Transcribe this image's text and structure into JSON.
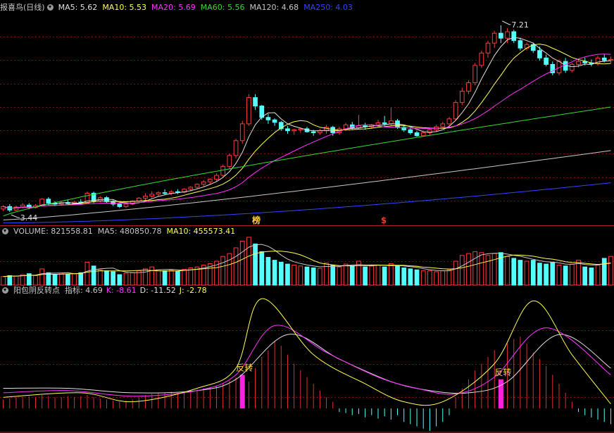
{
  "chart_data": [
    {
      "type": "candlestick",
      "title": "报喜鸟(日线)",
      "indicators": [
        {
          "name": "MA5",
          "value": "5.62",
          "color": "#e0e0e0"
        },
        {
          "name": "MA10",
          "value": "5.53",
          "color": "#ffff55"
        },
        {
          "name": "MA20",
          "value": "5.69",
          "color": "#ff33ff"
        },
        {
          "name": "MA60",
          "value": "5.56",
          "color": "#33dd33"
        },
        {
          "name": "MA120",
          "value": "4.68",
          "color": "#c8c8c8"
        },
        {
          "name": "MA250",
          "value": "4.03",
          "color": "#3344ff"
        }
      ],
      "high_label": "7.21",
      "low_label": "3.44",
      "markers": [
        {
          "text": "榜",
          "color": "#ffcc44"
        },
        {
          "text": "$",
          "color": "#ff3333"
        }
      ],
      "ylim": [
        3.2,
        7.45
      ],
      "bar_count": 95,
      "ohlc": [
        [
          3.5,
          3.58,
          3.46,
          3.55
        ],
        [
          3.55,
          3.6,
          3.44,
          3.48
        ],
        [
          3.48,
          3.57,
          3.46,
          3.54
        ],
        [
          3.54,
          3.62,
          3.51,
          3.58
        ],
        [
          3.58,
          3.62,
          3.5,
          3.53
        ],
        [
          3.53,
          3.6,
          3.51,
          3.57
        ],
        [
          3.57,
          3.72,
          3.55,
          3.7
        ],
        [
          3.7,
          3.74,
          3.58,
          3.62
        ],
        [
          3.62,
          3.66,
          3.56,
          3.6
        ],
        [
          3.6,
          3.65,
          3.57,
          3.63
        ],
        [
          3.63,
          3.68,
          3.59,
          3.61
        ],
        [
          3.61,
          3.66,
          3.58,
          3.64
        ],
        [
          3.64,
          3.7,
          3.6,
          3.62
        ],
        [
          3.62,
          3.85,
          3.6,
          3.82
        ],
        [
          3.82,
          3.85,
          3.62,
          3.66
        ],
        [
          3.66,
          3.76,
          3.64,
          3.73
        ],
        [
          3.73,
          3.76,
          3.62,
          3.65
        ],
        [
          3.65,
          3.68,
          3.56,
          3.6
        ],
        [
          3.6,
          3.62,
          3.52,
          3.55
        ],
        [
          3.55,
          3.63,
          3.52,
          3.6
        ],
        [
          3.6,
          3.68,
          3.58,
          3.66
        ],
        [
          3.66,
          3.74,
          3.64,
          3.72
        ],
        [
          3.72,
          3.82,
          3.68,
          3.76
        ],
        [
          3.76,
          3.86,
          3.72,
          3.8
        ],
        [
          3.8,
          3.86,
          3.76,
          3.83
        ],
        [
          3.83,
          3.9,
          3.78,
          3.82
        ],
        [
          3.82,
          3.88,
          3.78,
          3.85
        ],
        [
          3.85,
          3.9,
          3.8,
          3.84
        ],
        [
          3.84,
          3.92,
          3.82,
          3.9
        ],
        [
          3.9,
          3.96,
          3.86,
          3.94
        ],
        [
          3.94,
          4.02,
          3.9,
          4.0
        ],
        [
          4.0,
          4.08,
          3.96,
          4.05
        ],
        [
          4.05,
          4.12,
          4.0,
          4.1
        ],
        [
          4.1,
          4.22,
          4.06,
          4.18
        ],
        [
          4.18,
          4.4,
          4.15,
          4.36
        ],
        [
          4.36,
          4.62,
          4.3,
          4.58
        ],
        [
          4.58,
          4.92,
          4.52,
          4.88
        ],
        [
          4.88,
          5.28,
          4.82,
          5.22
        ],
        [
          5.22,
          5.82,
          5.18,
          5.75
        ],
        [
          5.75,
          5.82,
          5.5,
          5.58
        ],
        [
          5.58,
          5.6,
          5.3,
          5.35
        ],
        [
          5.35,
          5.42,
          5.22,
          5.3
        ],
        [
          5.3,
          5.33,
          5.18,
          5.25
        ],
        [
          5.25,
          5.28,
          5.08,
          5.12
        ],
        [
          5.12,
          5.18,
          5.02,
          5.08
        ],
        [
          5.08,
          5.12,
          5.0,
          5.1
        ],
        [
          5.1,
          5.14,
          5.04,
          5.12
        ],
        [
          5.12,
          5.16,
          5.04,
          5.06
        ],
        [
          5.06,
          5.1,
          4.98,
          5.04
        ],
        [
          5.04,
          5.12,
          5.0,
          5.08
        ],
        [
          5.08,
          5.2,
          5.02,
          5.15
        ],
        [
          5.15,
          5.18,
          4.98,
          5.04
        ],
        [
          5.04,
          5.16,
          5.0,
          5.12
        ],
        [
          5.12,
          5.24,
          5.08,
          5.2
        ],
        [
          5.2,
          5.26,
          5.1,
          5.14
        ],
        [
          5.14,
          5.4,
          5.12,
          5.18
        ],
        [
          5.18,
          5.24,
          5.1,
          5.16
        ],
        [
          5.16,
          5.22,
          5.12,
          5.2
        ],
        [
          5.2,
          5.3,
          5.16,
          5.24
        ],
        [
          5.24,
          5.38,
          5.18,
          5.22
        ],
        [
          5.22,
          5.55,
          5.18,
          5.28
        ],
        [
          5.28,
          5.32,
          5.12,
          5.15
        ],
        [
          5.15,
          5.2,
          5.06,
          5.1
        ],
        [
          5.1,
          5.14,
          5.0,
          5.04
        ],
        [
          5.04,
          5.08,
          4.96,
          4.98
        ],
        [
          4.98,
          5.06,
          4.96,
          5.04
        ],
        [
          5.04,
          5.14,
          5.0,
          5.1
        ],
        [
          5.1,
          5.2,
          5.06,
          5.16
        ],
        [
          5.16,
          5.26,
          5.12,
          5.22
        ],
        [
          5.22,
          5.36,
          5.18,
          5.32
        ],
        [
          5.32,
          5.7,
          5.3,
          5.65
        ],
        [
          5.65,
          5.95,
          5.6,
          5.88
        ],
        [
          5.88,
          6.1,
          5.82,
          6.05
        ],
        [
          6.05,
          6.45,
          6.0,
          6.4
        ],
        [
          6.4,
          6.7,
          6.35,
          6.65
        ],
        [
          6.65,
          6.9,
          6.55,
          6.85
        ],
        [
          6.85,
          7.1,
          6.75,
          7.05
        ],
        [
          7.05,
          7.21,
          6.85,
          6.95
        ],
        [
          6.95,
          7.15,
          6.85,
          7.08
        ],
        [
          7.08,
          7.12,
          6.85,
          6.9
        ],
        [
          6.9,
          6.96,
          6.7,
          6.75
        ],
        [
          6.75,
          6.86,
          6.7,
          6.82
        ],
        [
          6.82,
          6.86,
          6.65,
          6.7
        ],
        [
          6.7,
          6.78,
          6.5,
          6.55
        ],
        [
          6.55,
          6.62,
          6.38,
          6.42
        ],
        [
          6.42,
          6.48,
          6.2,
          6.25
        ],
        [
          6.25,
          6.52,
          6.2,
          6.48
        ],
        [
          6.48,
          6.55,
          6.25,
          6.3
        ],
        [
          6.3,
          6.45,
          6.26,
          6.42
        ],
        [
          6.42,
          6.52,
          6.36,
          6.48
        ],
        [
          6.48,
          6.56,
          6.4,
          6.45
        ],
        [
          6.45,
          6.52,
          6.38,
          6.44
        ],
        [
          6.44,
          6.6,
          6.4,
          6.55
        ],
        [
          6.55,
          6.62,
          6.46,
          6.5
        ],
        [
          6.5,
          6.58,
          6.44,
          6.52
        ]
      ],
      "ma_series": [
        {
          "name": "MA60",
          "start": 3.36,
          "end": 5.56,
          "bend": 0.85
        },
        {
          "name": "MA120",
          "start": 3.28,
          "end": 4.68,
          "bend": 1.2
        },
        {
          "name": "MA250",
          "start": 3.22,
          "end": 4.03,
          "bend": 1.6
        }
      ]
    },
    {
      "type": "bar",
      "title": "VOLUME",
      "indicators": [
        {
          "name": "VOLUME",
          "value": "821558.81",
          "color": "#c8c8c8"
        },
        {
          "name": "MA5",
          "value": "480850.78",
          "color": "#c8c8c8"
        },
        {
          "name": "MA10",
          "value": "455573.41",
          "color": "#ffff55"
        }
      ],
      "ylim": [
        0,
        1.0
      ],
      "volume": [
        0.18,
        0.2,
        0.19,
        0.22,
        0.24,
        0.2,
        0.34,
        0.26,
        0.22,
        0.25,
        0.23,
        0.24,
        0.26,
        0.48,
        0.4,
        0.32,
        0.3,
        0.28,
        0.22,
        0.25,
        0.26,
        0.3,
        0.34,
        0.38,
        0.32,
        0.3,
        0.31,
        0.29,
        0.33,
        0.36,
        0.38,
        0.42,
        0.45,
        0.5,
        0.6,
        0.66,
        0.78,
        0.92,
        1.0,
        0.86,
        0.7,
        0.58,
        0.52,
        0.48,
        0.44,
        0.42,
        0.4,
        0.38,
        0.36,
        0.35,
        0.46,
        0.42,
        0.38,
        0.44,
        0.4,
        0.5,
        0.38,
        0.4,
        0.42,
        0.38,
        0.45,
        0.4,
        0.36,
        0.34,
        0.32,
        0.3,
        0.3,
        0.28,
        0.3,
        0.32,
        0.5,
        0.62,
        0.66,
        0.7,
        0.68,
        0.62,
        0.66,
        0.68,
        0.6,
        0.56,
        0.52,
        0.5,
        0.52,
        0.46,
        0.44,
        0.48,
        0.42,
        0.4,
        0.44,
        0.52,
        0.38,
        0.36,
        0.42,
        0.56,
        0.6
      ]
    },
    {
      "type": "bar",
      "title": "阳包阴反转点",
      "indicators": [
        {
          "name": "指标",
          "value": "4.69",
          "color": "#c8c8c8"
        },
        {
          "name": "K",
          "value": "-8.61",
          "color": "#ff33ff"
        },
        {
          "name": "D",
          "value": "-11.52",
          "color": "#e0e0e0"
        },
        {
          "name": "J",
          "value": "-2.78",
          "color": "#ffff55"
        }
      ],
      "signal_label": "反转",
      "ylim": [
        -20,
        100
      ],
      "signal_index": [
        37,
        77
      ],
      "histogram": [
        8,
        9,
        10,
        10,
        11,
        10,
        12,
        11,
        10,
        10,
        11,
        10,
        11,
        12,
        10,
        9,
        8,
        7,
        6,
        7,
        8,
        10,
        12,
        13,
        14,
        14,
        15,
        14,
        15,
        16,
        17,
        18,
        19,
        20,
        22,
        25,
        28,
        30,
        24,
        36,
        46,
        52,
        60,
        56,
        48,
        40,
        34,
        28,
        22,
        16,
        10,
        6,
        -3,
        -4,
        -6,
        -5,
        -8,
        -6,
        -9,
        -7,
        -10,
        -6,
        -12,
        -14,
        -16,
        -18,
        -20,
        -16,
        -12,
        -6,
        10,
        18,
        26,
        34,
        40,
        46,
        52,
        26,
        58,
        62,
        64,
        58,
        50,
        44,
        38,
        30,
        22,
        14,
        6,
        -3,
        -6,
        -8,
        -10,
        -12,
        -14
      ],
      "kdj_anchors": {
        "K": [
          [
            0,
            14
          ],
          [
            10,
            16
          ],
          [
            20,
            11
          ],
          [
            30,
            16
          ],
          [
            36,
            30
          ],
          [
            42,
            74
          ],
          [
            50,
            50
          ],
          [
            58,
            28
          ],
          [
            64,
            18
          ],
          [
            70,
            13
          ],
          [
            76,
            28
          ],
          [
            84,
            72
          ],
          [
            94,
            30
          ]
        ],
        "D": [
          [
            0,
            18
          ],
          [
            10,
            18
          ],
          [
            20,
            14
          ],
          [
            30,
            16
          ],
          [
            36,
            26
          ],
          [
            44,
            66
          ],
          [
            52,
            44
          ],
          [
            60,
            24
          ],
          [
            66,
            16
          ],
          [
            72,
            14
          ],
          [
            78,
            24
          ],
          [
            86,
            66
          ],
          [
            94,
            36
          ]
        ],
        "J": [
          [
            0,
            10
          ],
          [
            12,
            14
          ],
          [
            20,
            6
          ],
          [
            30,
            18
          ],
          [
            36,
            36
          ],
          [
            40,
            98
          ],
          [
            48,
            48
          ],
          [
            56,
            22
          ],
          [
            62,
            6
          ],
          [
            68,
            6
          ],
          [
            76,
            40
          ],
          [
            82,
            96
          ],
          [
            88,
            48
          ],
          [
            94,
            4
          ]
        ]
      }
    }
  ]
}
